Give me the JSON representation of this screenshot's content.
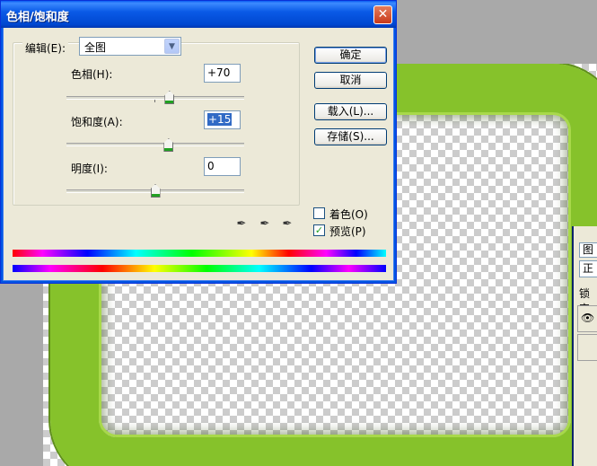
{
  "dialog": {
    "title": "色相/饱和度",
    "close_icon": "close-icon",
    "edit": {
      "label": "编辑(E):",
      "selected": "全图"
    },
    "params": [
      {
        "label": "色相(H):",
        "value": "+70",
        "slider_fraction": 0.58
      },
      {
        "label": "饱和度(A):",
        "value": "+15",
        "slider_fraction": 0.575
      },
      {
        "label": "明度(I):",
        "value": "0",
        "slider_fraction": 0.5
      }
    ],
    "buttons": {
      "ok": "确定",
      "cancel": "取消",
      "load": "载入(L)...",
      "save": "存储(S)..."
    },
    "checkboxes": {
      "colorize": {
        "label": "着色(O)",
        "checked": false
      },
      "preview": {
        "label": "预览(P)",
        "checked": true
      }
    },
    "eyedropper_icons": [
      "eyedropper-icon",
      "eyedropper-plus-icon",
      "eyedropper-minus-icon"
    ]
  },
  "layers_panel": {
    "tab_label": "图",
    "blend_mode": "正",
    "lock_label": "锁定"
  },
  "colors": {
    "title_bar": "#0054e3",
    "dialog_bg": "#ece9d8",
    "frame_green": "#86c22b",
    "selection": "#316ac5"
  }
}
